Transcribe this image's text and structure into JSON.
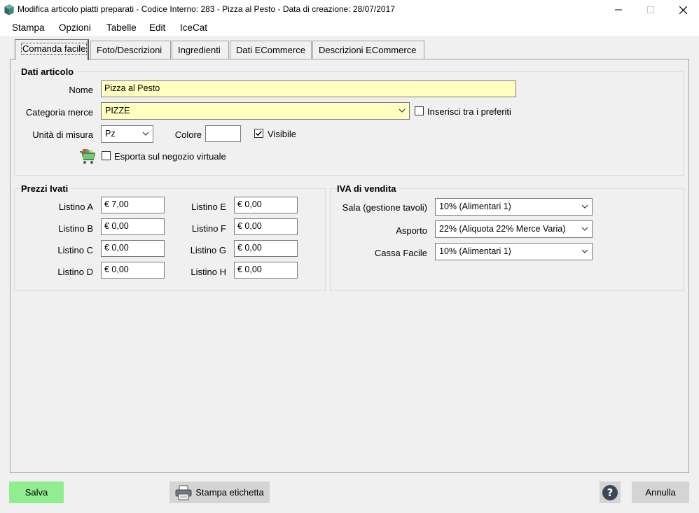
{
  "window": {
    "title": "Modifica articolo piatti preparati - Codice Interno: 283 - Pizza al Pesto - Data di creazione: 28/07/2017",
    "icon": "app-cube-icon",
    "controls": [
      "minimize-icon",
      "maximize-icon",
      "close-icon"
    ]
  },
  "menu": {
    "items": [
      "Stampa",
      "Opzioni",
      "Tabelle",
      "Edit",
      "IceCat"
    ]
  },
  "tabs": [
    {
      "label": "Comanda facile",
      "active": true
    },
    {
      "label": "Foto/Descrizioni",
      "active": false
    },
    {
      "label": "Ingredienti",
      "active": false
    },
    {
      "label": "Dati ECommerce",
      "active": false
    },
    {
      "label": "Descrizioni ECommerce",
      "active": false
    }
  ],
  "dati_articolo": {
    "title": "Dati articolo",
    "nome_label": "Nome",
    "nome_value": "Pizza al Pesto",
    "categoria_label": "Categoria merce",
    "categoria_value": "PIZZE",
    "preferiti_label": "Inserisci tra i preferiti",
    "preferiti_checked": false,
    "unita_label": "Unità di misura",
    "unita_value": "Pz",
    "colore_label": "Colore",
    "colore_value": "",
    "visibile_label": "Visibile",
    "visibile_checked": true,
    "esporta_label": "Esporta sul negozio virtuale",
    "esporta_checked": false,
    "cart_icon": "shopping-cart-icon"
  },
  "prezzi": {
    "title": "Prezzi Ivati",
    "listini": [
      {
        "label": "Listino A",
        "value": "€ 7,00"
      },
      {
        "label": "Listino B",
        "value": "€ 0,00"
      },
      {
        "label": "Listino C",
        "value": "€ 0,00"
      },
      {
        "label": "Listino D",
        "value": "€ 0,00"
      },
      {
        "label": "Listino E",
        "value": "€ 0,00"
      },
      {
        "label": "Listino F",
        "value": "€ 0,00"
      },
      {
        "label": "Listino G",
        "value": "€ 0,00"
      },
      {
        "label": "Listino H",
        "value": "€ 0,00"
      }
    ]
  },
  "iva": {
    "title": "IVA di vendita",
    "rows": [
      {
        "label": "Sala (gestione tavoli)",
        "value": "10% (Alimentari 1)"
      },
      {
        "label": "Asporto",
        "value": "22% (Aliquota 22% Merce Varia)"
      },
      {
        "label": "Cassa Facile",
        "value": "10% (Alimentari 1)"
      }
    ]
  },
  "footer": {
    "salva_label": "Salva",
    "stampa_label": "Stampa etichetta",
    "help_icon": "help-icon",
    "printer_icon": "printer-icon",
    "annulla_label": "Annulla"
  },
  "colors": {
    "input_highlight": "#ffffc0",
    "salva_button": "#90ee90",
    "button_gray": "#d4d4d4"
  }
}
